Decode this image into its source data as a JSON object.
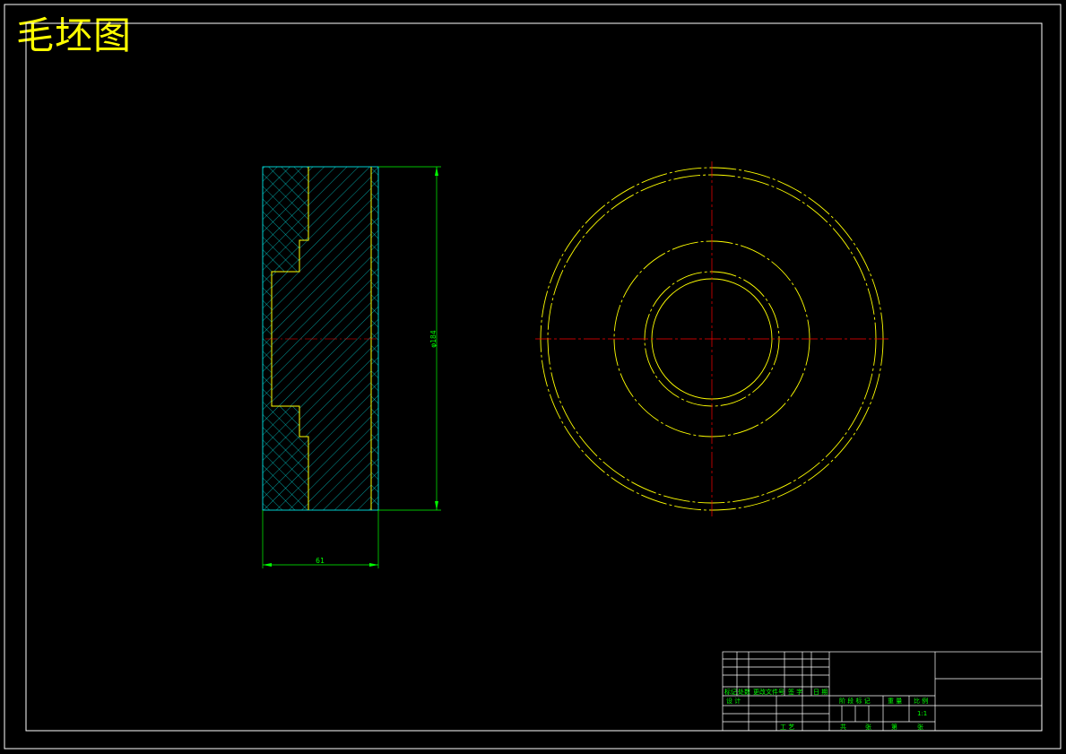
{
  "drawing_title": "毛坯图",
  "dimensions": {
    "height_label": "φ184",
    "width_label": "61"
  },
  "title_block": {
    "row_labels": [
      "标记",
      "处数",
      "更改文件号",
      "签 字",
      "日 期"
    ],
    "design_label": "设 计",
    "stage_labels": [
      "阶 段 标 记",
      "重 量",
      "比 例"
    ],
    "scale_value": "1:1",
    "process_label": "工 艺",
    "approve_label": "批 准",
    "sheet_labels": [
      "共",
      "张",
      "第",
      "张"
    ],
    "check_labels": [
      "审 核",
      "标准化"
    ]
  },
  "colors": {
    "frame": "#ffffff",
    "outline": "#ffff00",
    "hatch": "#00ffff",
    "dimension": "#00ff00",
    "centerline": "#ff0000"
  }
}
